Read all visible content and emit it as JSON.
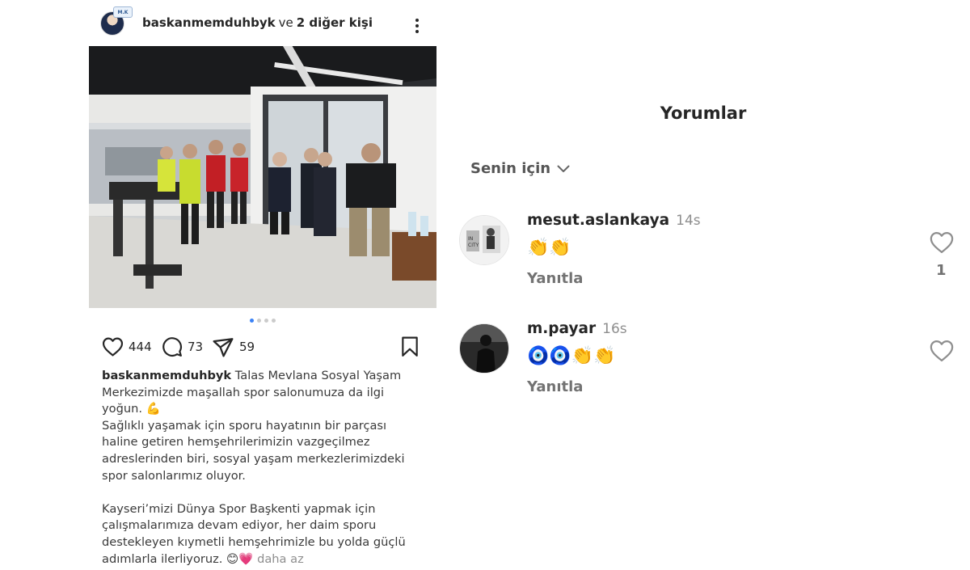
{
  "post": {
    "header": {
      "username": "baskanmemduhbyk",
      "and_text": "ve",
      "others_text": "2 diğer kişi"
    },
    "carousel": {
      "count": 4,
      "active": 1
    },
    "actions": {
      "likes": "444",
      "comments": "73",
      "shares": "59"
    },
    "caption": {
      "username": "baskanmemduhbyk",
      "p1": "Talas Mevlana Sosyal Yaşam Merkezimizde maşallah spor salonumuza da ilgi yoğun. 💪",
      "p2": "Sağlıklı yaşamak için sporu hayatının bir parçası haline getiren hemşehrilerimizin vazgeçilmez adreslerinden biri, sosyal yaşam merkezlerimizdeki spor salonlarımız oluyor.",
      "p3": "Kayseri’mizi Dünya Spor Başkenti yapmak için çalışmalarımıza devam ediyor, her daim sporu destekleyen kıymetli hemşehrimizle bu yolda güçlü adımlarla ilerliyoruz. 😊💗",
      "less_label": "daha az"
    }
  },
  "comments_panel": {
    "title": "Yorumlar",
    "sort_label": "Senin için",
    "comments": [
      {
        "username": "mesut.aslankaya",
        "time": "14s",
        "text": "👏👏",
        "reply_label": "Yanıtla",
        "likes": "1"
      },
      {
        "username": "m.payar",
        "time": "16s",
        "text": "🧿🧿👏👏",
        "reply_label": "Yanıtla",
        "likes": ""
      }
    ]
  },
  "icons": {
    "like": "heart-icon",
    "comment": "speech-bubble-icon",
    "share": "paper-plane-icon",
    "save": "bookmark-icon",
    "more": "vertical-ellipsis-icon",
    "sort": "chevron-down-icon"
  },
  "colors": {
    "text": "#262626",
    "muted": "#8e8e8e",
    "active_dot": "#3b82f6"
  }
}
